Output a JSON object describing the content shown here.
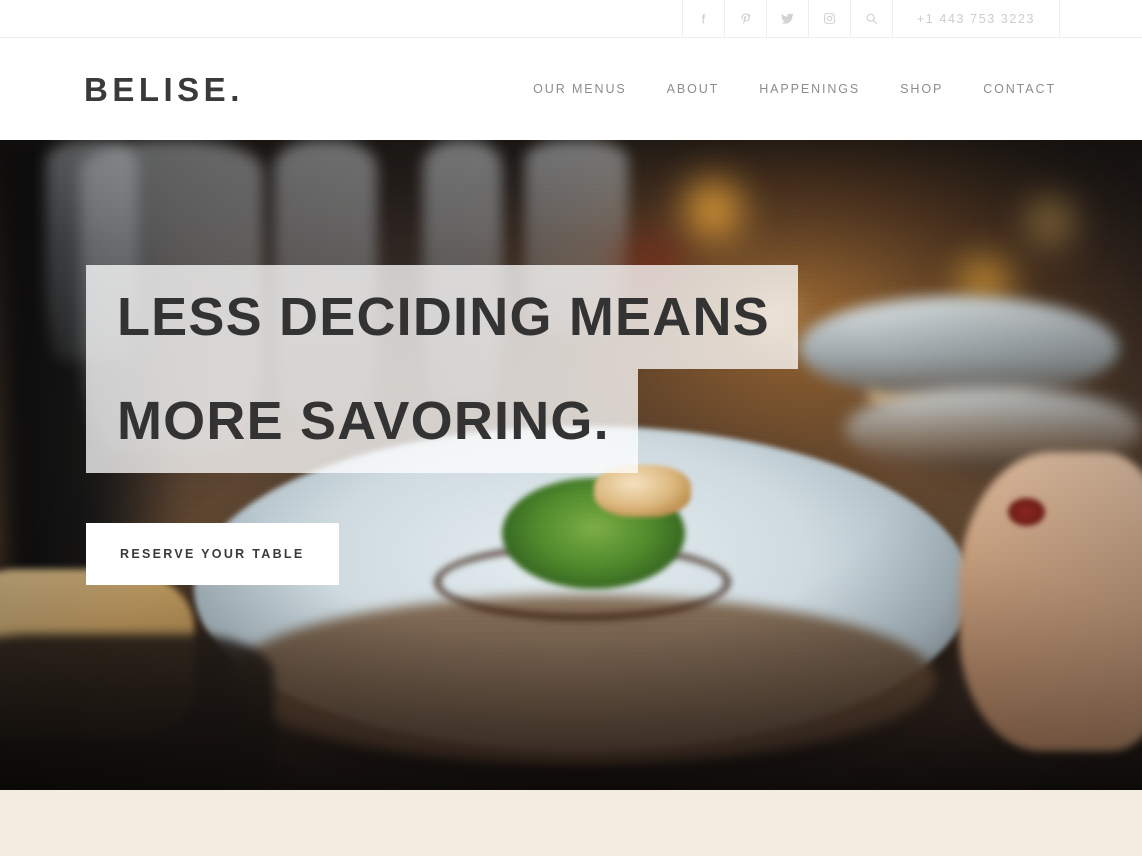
{
  "topbar": {
    "social": [
      {
        "name": "facebook-icon",
        "label": "Facebook"
      },
      {
        "name": "pinterest-icon",
        "label": "Pinterest"
      },
      {
        "name": "twitter-icon",
        "label": "Twitter"
      },
      {
        "name": "instagram-icon",
        "label": "Instagram"
      },
      {
        "name": "search-icon",
        "label": "Search"
      }
    ],
    "phone": "+1 443 753 3223"
  },
  "header": {
    "logo": "BELISE.",
    "nav": [
      {
        "label": "OUR MENUS"
      },
      {
        "label": "ABOUT"
      },
      {
        "label": "HAPPENINGS"
      },
      {
        "label": "SHOP"
      },
      {
        "label": "CONTACT"
      }
    ]
  },
  "hero": {
    "headline_line_1": "LESS DECIDING MEANS",
    "headline_line_2": "MORE SAVORING.",
    "cta_label": "RESERVE YOUR TABLE",
    "image_alt": "Plated fish dish with microgreens and balsamic reduction served in a restaurant"
  },
  "colors": {
    "text_dark": "#333333",
    "nav_gray": "#8d8d8d",
    "topbar_gray": "#cdcdcd",
    "cream_section": "#f2ece1",
    "headline_block": "rgba(255,255,255,0.76)"
  }
}
